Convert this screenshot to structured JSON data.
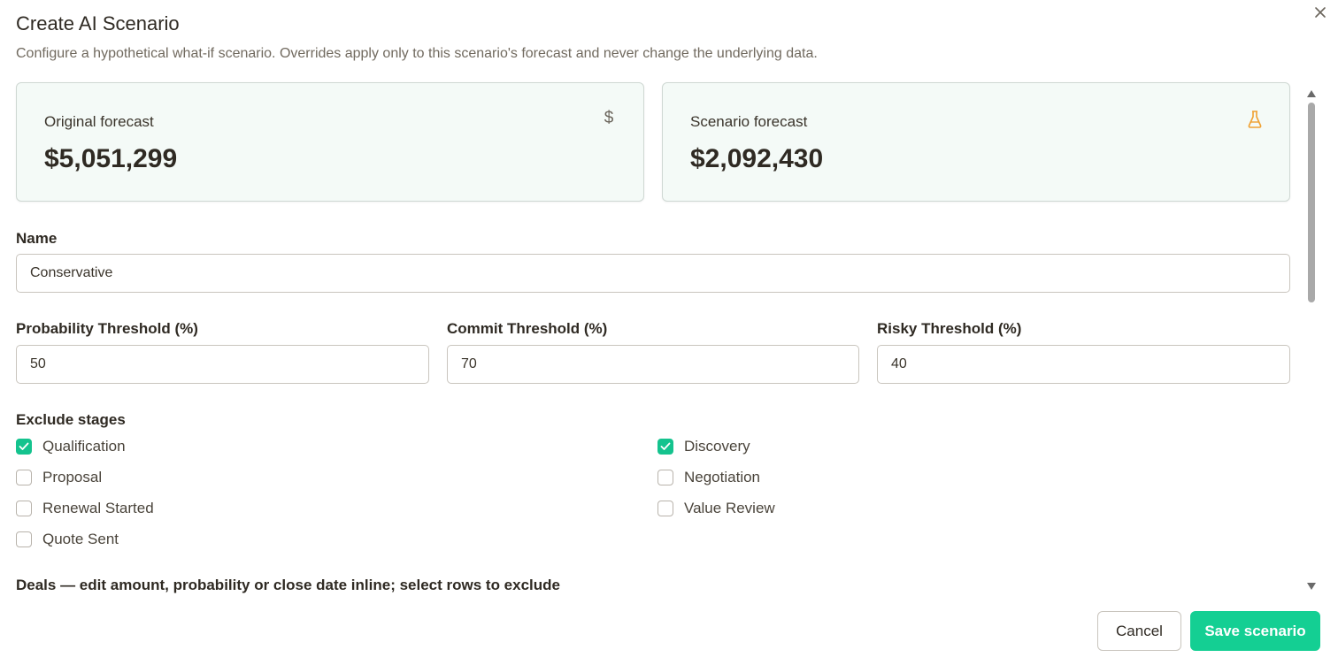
{
  "dialog": {
    "title": "Create AI Scenario",
    "subtitle": "Configure a hypothetical what-if scenario. Overrides apply only to this scenario's forecast and never change the underlying data.",
    "close_icon": "close-icon"
  },
  "cards": {
    "original": {
      "label": "Original forecast",
      "value": "$5,051,299",
      "icon": "dollar-icon",
      "icon_glyph": "$"
    },
    "scenario": {
      "label": "Scenario forecast",
      "value": "$2,092,430",
      "icon": "flask-icon",
      "icon_color": "#f0a030"
    }
  },
  "form": {
    "name_label": "Name",
    "name_value": "Conservative",
    "probability_label": "Probability Threshold (%)",
    "probability_value": "50",
    "commit_label": "Commit Threshold (%)",
    "commit_value": "70",
    "risky_label": "Risky Threshold (%)",
    "risky_value": "40"
  },
  "exclude": {
    "label": "Exclude stages",
    "stages": [
      {
        "label": "Qualification",
        "checked": true
      },
      {
        "label": "Discovery",
        "checked": true
      },
      {
        "label": "Proposal",
        "checked": false
      },
      {
        "label": "Negotiation",
        "checked": false
      },
      {
        "label": "Renewal Started",
        "checked": false
      },
      {
        "label": "Value Review",
        "checked": false
      },
      {
        "label": "Quote Sent",
        "checked": false
      }
    ]
  },
  "deals": {
    "label": "Deals — edit amount, probability or close date inline; select rows to exclude"
  },
  "actions": {
    "cancel_label": "Cancel",
    "save_label": "Save scenario"
  },
  "colors": {
    "accent": "#14c38e",
    "card_bg": "#f4faf7"
  }
}
